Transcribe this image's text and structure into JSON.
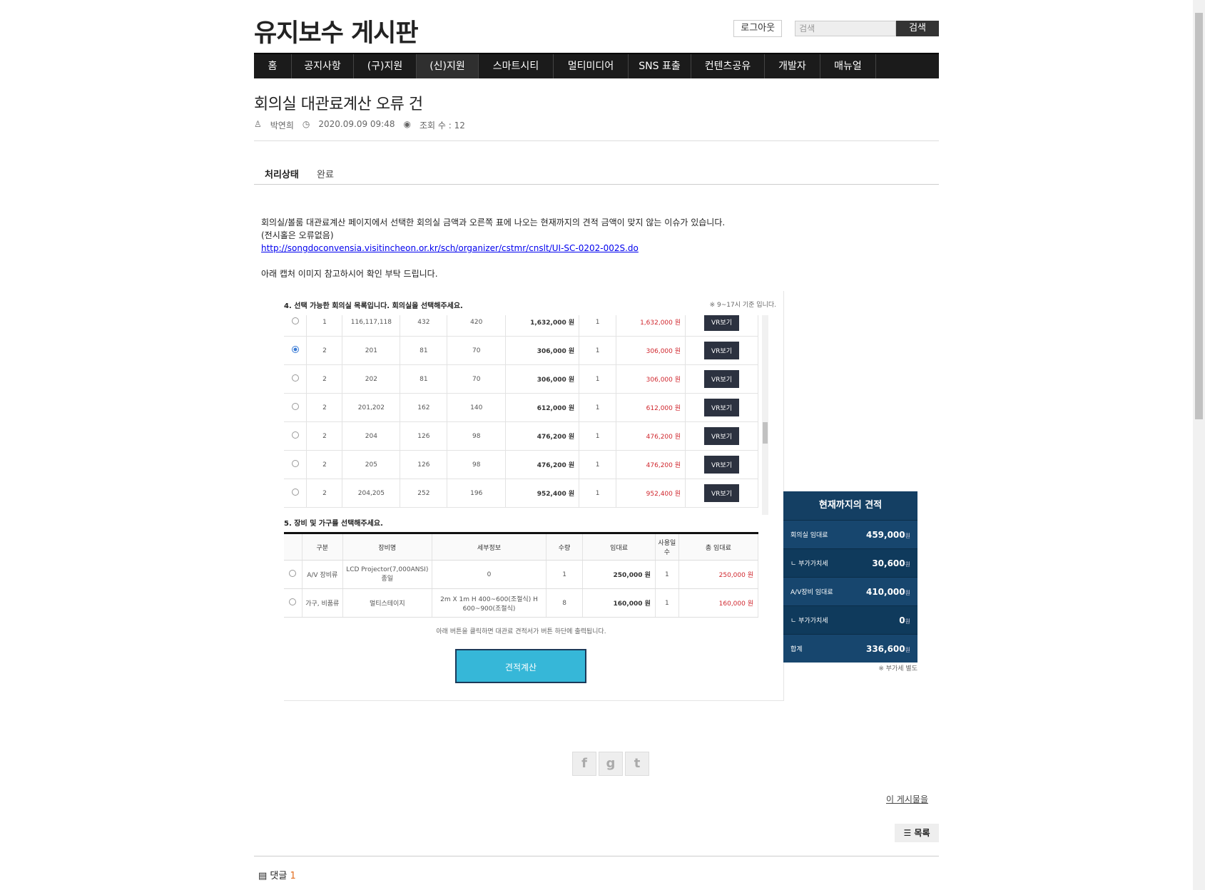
{
  "site": {
    "title": "유지보수 게시판",
    "logout_label": "로그아웃",
    "search_placeholder": "검색",
    "search_label": "검색"
  },
  "nav": [
    "홈",
    "공지사항",
    "(구)지원",
    "(신)지원",
    "스마트시티",
    "멀티미디어",
    "SNS 표출",
    "컨텐츠공유",
    "개발자",
    "매뉴얼"
  ],
  "post": {
    "title": "회의실 대관료계산 오류 건",
    "author": "박연희",
    "datetime": "2020.09.09 09:48",
    "views": "조회 수 : 12",
    "status_label": "처리상태",
    "status_value": "완료",
    "line1": "회의실/볼룸 대관료계산 페이지에서 선택한 회의실 금액과 오른쪽 표에 나오는 현재까지의 견적 금액이 맞지 않는 이슈가 있습니다.",
    "line2": "(전시홀은 오류없음)",
    "link": "http://songdoconvensia.visitincheon.or.kr/sch/organizer/cstmr/cnslt/UI-SC-0202-002S.do",
    "line3": "아래 캡처 이미지 참고하시어 확인 부탁 드립니다."
  },
  "capture": {
    "section4_title": "4. 선택 가능한 회의실 목록입니다. 회의실을 선택해주세요.",
    "section4_note": "※ 9~17시 기준 입니다.",
    "vr_label": "VR보기",
    "rooms": [
      {
        "floor": "1",
        "room": "116,117,118",
        "a": "432",
        "b": "420",
        "price": "1,632,000 원",
        "qty": "1",
        "total": "1,632,000 원",
        "selected": false
      },
      {
        "floor": "2",
        "room": "201",
        "a": "81",
        "b": "70",
        "price": "306,000 원",
        "qty": "1",
        "total": "306,000 원",
        "selected": true
      },
      {
        "floor": "2",
        "room": "202",
        "a": "81",
        "b": "70",
        "price": "306,000 원",
        "qty": "1",
        "total": "306,000 원",
        "selected": false
      },
      {
        "floor": "2",
        "room": "201,202",
        "a": "162",
        "b": "140",
        "price": "612,000 원",
        "qty": "1",
        "total": "612,000 원",
        "selected": false
      },
      {
        "floor": "2",
        "room": "204",
        "a": "126",
        "b": "98",
        "price": "476,200 원",
        "qty": "1",
        "total": "476,200 원",
        "selected": false
      },
      {
        "floor": "2",
        "room": "205",
        "a": "126",
        "b": "98",
        "price": "476,200 원",
        "qty": "1",
        "total": "476,200 원",
        "selected": false
      },
      {
        "floor": "2",
        "room": "204,205",
        "a": "252",
        "b": "196",
        "price": "952,400 원",
        "qty": "1",
        "total": "952,400 원",
        "selected": false
      }
    ],
    "section5_title": "5. 장비 및 가구를 선택해주세요.",
    "equip_headers": [
      "구분",
      "장비명",
      "세부정보",
      "수량",
      "임대료",
      "사용일수",
      "총 임대료"
    ],
    "equipment": [
      {
        "cat": "A/V 장비류",
        "name": "LCD Projector(7,000ANSI) 종일",
        "detail": "0",
        "qty": "1",
        "rent": "250,000 원",
        "days": "1",
        "total": "250,000 원"
      },
      {
        "cat": "가구, 비품류",
        "name": "멀티스테이지",
        "detail": "2m X 1m H 400~600(조절식) H 600~900(조절식)",
        "qty": "8",
        "rent": "160,000 원",
        "days": "1",
        "total": "160,000 원"
      }
    ],
    "hint": "아래 버튼을 클릭하면 대관료 견적서가 버튼 하단에 출력됩니다.",
    "calc_label": "견적계산",
    "estimate": {
      "title": "현재까지의 견적",
      "rows": [
        {
          "label": "회의실 임대료",
          "value": "459,000"
        },
        {
          "label": "ㄴ 부가가치세",
          "value": "30,600"
        },
        {
          "label": "A/V장비 임대료",
          "value": "410,000"
        },
        {
          "label": "ㄴ 부가가치세",
          "value": "0"
        },
        {
          "label": "합계",
          "value": "336,600"
        }
      ],
      "unit": "원",
      "note": "※ 부가세 별도"
    }
  },
  "footer": {
    "this_post": "이 게시물을",
    "list_label": "목록",
    "comments_label": "댓글",
    "comments_count": "1"
  }
}
